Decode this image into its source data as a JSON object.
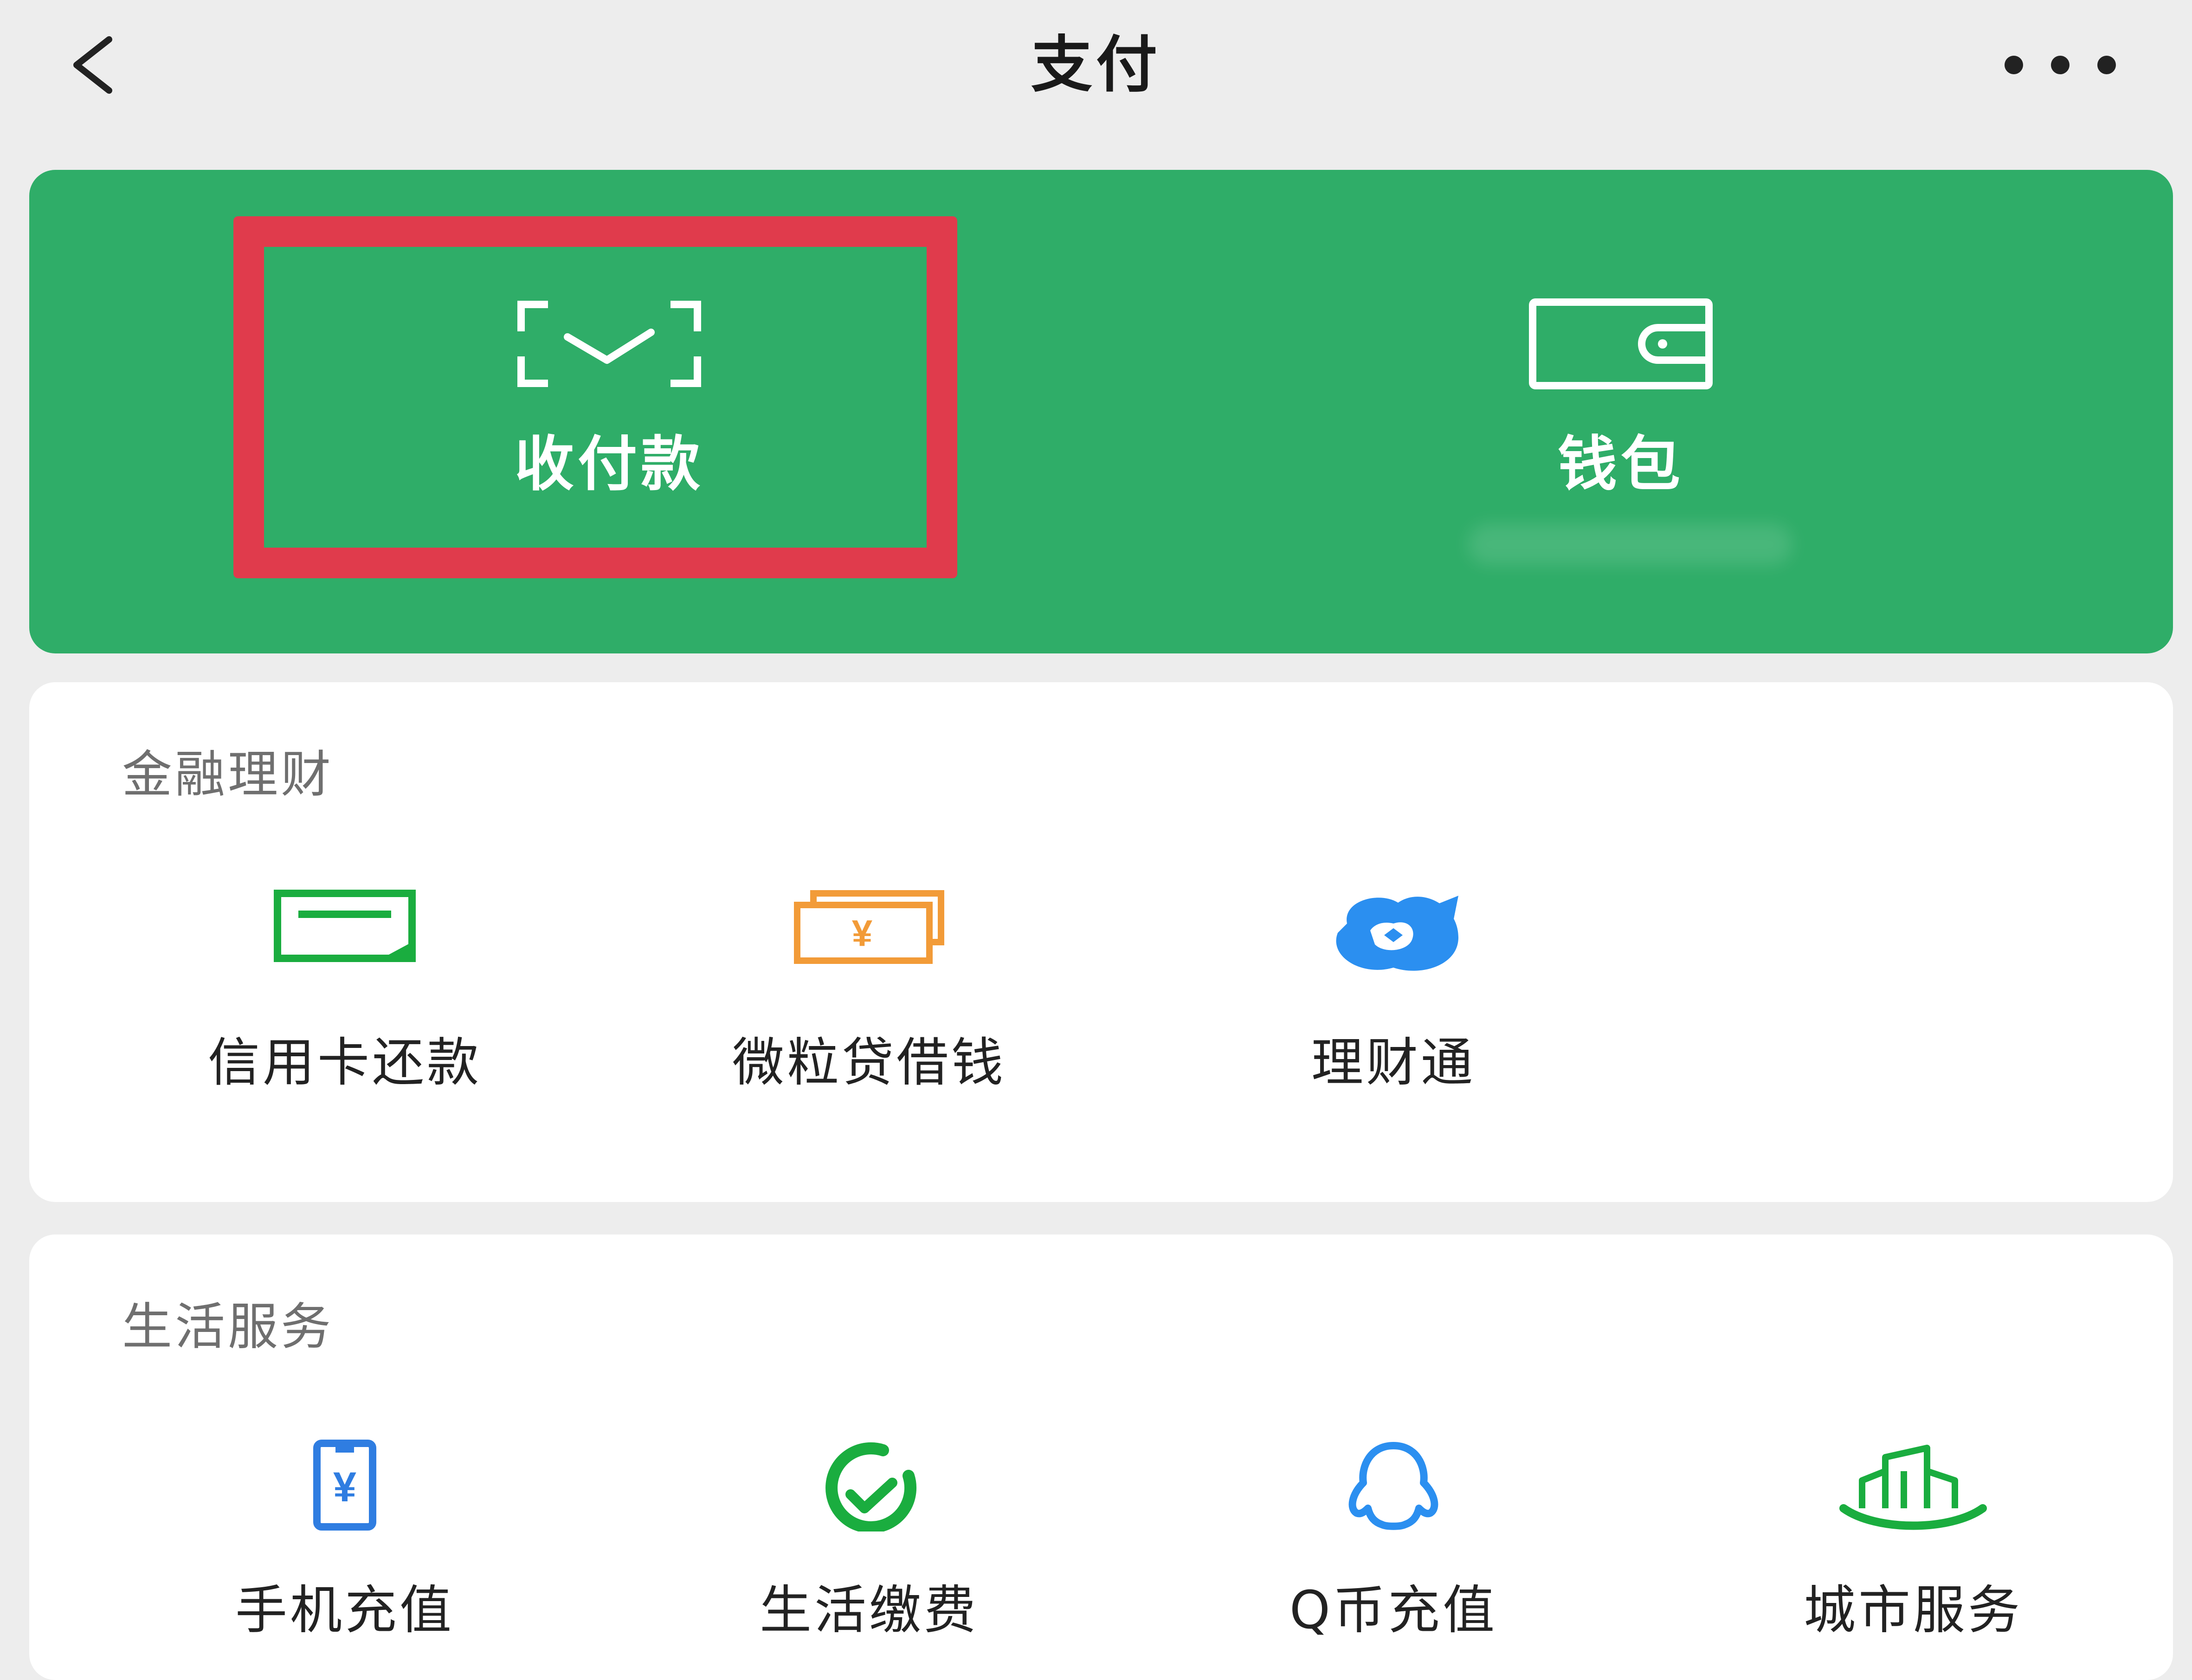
{
  "header": {
    "title": "支付",
    "back_icon": "back-chevron-icon",
    "more_icon": "more-dots-icon"
  },
  "pay_card": {
    "items": [
      {
        "label": "收付款",
        "icon": "scan-check-icon"
      },
      {
        "label": "钱包",
        "icon": "wallet-icon"
      }
    ]
  },
  "sections": [
    {
      "title": "金融理财",
      "items": [
        {
          "label": "信用卡还款",
          "icon": "credit-card-icon",
          "color": "#1aad3f"
        },
        {
          "label": "微粒贷借钱",
          "icon": "cash-stack-icon",
          "color": "#f29b38"
        },
        {
          "label": "理财通",
          "icon": "licaitong-icon",
          "color": "#2b8ff0"
        }
      ]
    },
    {
      "title": "生活服务",
      "items": [
        {
          "label": "手机充值",
          "icon": "phone-recharge-icon",
          "color": "#2f7de1"
        },
        {
          "label": "生活缴费",
          "icon": "utility-pay-icon",
          "color": "#1aad3f"
        },
        {
          "label": "Q币充值",
          "icon": "qq-coin-icon",
          "color": "#2b8ff0"
        },
        {
          "label": "城市服务",
          "icon": "city-service-icon",
          "color": "#1aad3f"
        }
      ]
    }
  ],
  "colors": {
    "brand_green": "#2fad68",
    "highlight_red": "#e03b4c",
    "background": "#ededed"
  }
}
